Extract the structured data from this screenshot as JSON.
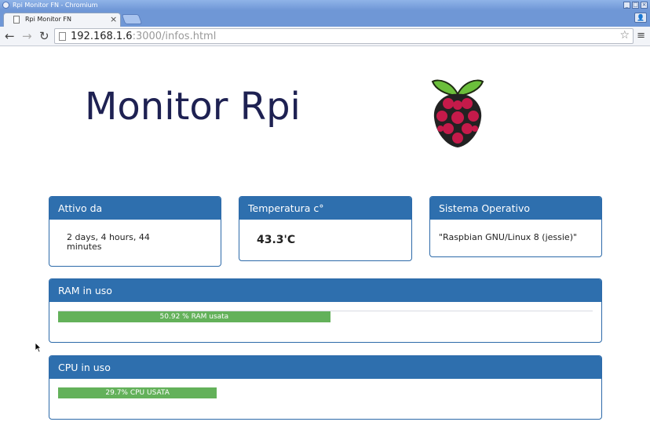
{
  "window": {
    "title": "Rpi Monitor FN - Chromium"
  },
  "tab": {
    "title": "Rpi Monitor FN",
    "close_label": "×"
  },
  "omnibox": {
    "host": "192.168.1.6",
    "path": ":3000/infos.html"
  },
  "page": {
    "heading": "Monitor Rpi"
  },
  "cards": {
    "uptime": {
      "title": "Attivo da",
      "value": "2 days, 4 hours, 44 minutes"
    },
    "temperature": {
      "title": "Temperatura c°",
      "value": "43.3'C"
    },
    "os": {
      "title": "Sistema Operativo",
      "value": "\"Raspbian GNU/Linux 8 (jessie)\""
    }
  },
  "ram": {
    "title": "RAM in uso",
    "bar_label": "50.92 % RAM usata",
    "percent": 50.92
  },
  "cpu": {
    "title": "CPU in uso",
    "bar_label": "29.7% CPU USATA",
    "percent": 29.7
  },
  "colors": {
    "panel_header": "#2e6fae",
    "progress_fill": "#63b15a",
    "heading_text": "#1e2152"
  }
}
